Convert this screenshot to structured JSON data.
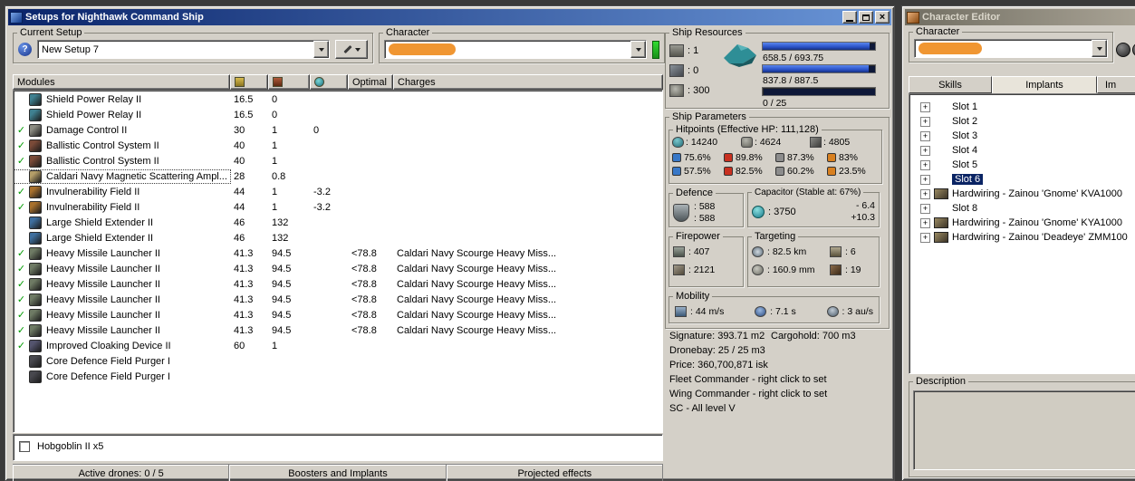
{
  "colors": {
    "redaction": "#f09632",
    "check_green": "#009a00",
    "bar_fill": "#2a52c8",
    "bar_bg": "#0e1838",
    "selection": "#0a2464",
    "indicator_green": "#32dc32",
    "title_active_left": "#0a246a",
    "title_active_right": "#6a96d8",
    "title_inactive_left": "#716e62",
    "title_inactive_right": "#aaa496"
  },
  "main_window": {
    "title": "Setups for Nighthawk Command Ship",
    "window_buttons": [
      "minimize-icon",
      "maximize-icon",
      "close-icon"
    ],
    "current_setup": {
      "legend": "Current Setup",
      "value": "New Setup 7"
    },
    "character_group": {
      "legend": "Character"
    },
    "modules": {
      "columns": {
        "name": "Modules",
        "cpu_icon": "cpu-column-icon",
        "pg_icon": "powergrid-column-icon",
        "cap_icon": "capacitor-column-icon",
        "optimal": "Optimal",
        "charges": "Charges"
      },
      "rows": [
        {
          "check": false,
          "selected": false,
          "icon_color": "#3f8090",
          "name": "Shield Power Relay II",
          "cpu": "16.5",
          "pg": "0",
          "cap": "",
          "optimal": "",
          "charges": ""
        },
        {
          "check": false,
          "selected": false,
          "icon_color": "#3f8090",
          "name": "Shield Power Relay II",
          "cpu": "16.5",
          "pg": "0",
          "cap": "",
          "optimal": "",
          "charges": ""
        },
        {
          "check": true,
          "selected": false,
          "icon_color": "#8c8c82",
          "name": "Damage Control II",
          "cpu": "30",
          "pg": "1",
          "cap": "0",
          "optimal": "",
          "charges": ""
        },
        {
          "check": true,
          "selected": false,
          "icon_color": "#7a4a38",
          "name": "Ballistic Control System II",
          "cpu": "40",
          "pg": "1",
          "cap": "",
          "optimal": "",
          "charges": ""
        },
        {
          "check": true,
          "selected": false,
          "icon_color": "#7a4a38",
          "name": "Ballistic Control System II",
          "cpu": "40",
          "pg": "1",
          "cap": "",
          "optimal": "",
          "charges": ""
        },
        {
          "check": false,
          "selected": true,
          "icon_color": "#b49e68",
          "name": "Caldari Navy Magnetic Scattering Ampl...",
          "cpu": "28",
          "pg": "0.8",
          "cap": "",
          "optimal": "",
          "charges": ""
        },
        {
          "check": true,
          "selected": false,
          "icon_color": "#a8702c",
          "name": "Invulnerability Field II",
          "cpu": "44",
          "pg": "1",
          "cap": "-3.2",
          "optimal": "",
          "charges": ""
        },
        {
          "check": true,
          "selected": false,
          "icon_color": "#a8702c",
          "name": "Invulnerability Field II",
          "cpu": "44",
          "pg": "1",
          "cap": "-3.2",
          "optimal": "",
          "charges": ""
        },
        {
          "check": false,
          "selected": false,
          "icon_color": "#3e6e9e",
          "name": "Large Shield Extender II",
          "cpu": "46",
          "pg": "132",
          "cap": "",
          "optimal": "",
          "charges": ""
        },
        {
          "check": false,
          "selected": false,
          "icon_color": "#3e6e9e",
          "name": "Large Shield Extender II",
          "cpu": "46",
          "pg": "132",
          "cap": "",
          "optimal": "",
          "charges": ""
        },
        {
          "check": true,
          "selected": false,
          "icon_color": "#6e7a64",
          "name": "Heavy Missile Launcher II",
          "cpu": "41.3",
          "pg": "94.5",
          "cap": "",
          "optimal": "<78.8",
          "charges": "Caldari Navy Scourge Heavy Miss..."
        },
        {
          "check": true,
          "selected": false,
          "icon_color": "#6e7a64",
          "name": "Heavy Missile Launcher II",
          "cpu": "41.3",
          "pg": "94.5",
          "cap": "",
          "optimal": "<78.8",
          "charges": "Caldari Navy Scourge Heavy Miss..."
        },
        {
          "check": true,
          "selected": false,
          "icon_color": "#6e7a64",
          "name": "Heavy Missile Launcher II",
          "cpu": "41.3",
          "pg": "94.5",
          "cap": "",
          "optimal": "<78.8",
          "charges": "Caldari Navy Scourge Heavy Miss..."
        },
        {
          "check": true,
          "selected": false,
          "icon_color": "#6e7a64",
          "name": "Heavy Missile Launcher II",
          "cpu": "41.3",
          "pg": "94.5",
          "cap": "",
          "optimal": "<78.8",
          "charges": "Caldari Navy Scourge Heavy Miss..."
        },
        {
          "check": true,
          "selected": false,
          "icon_color": "#6e7a64",
          "name": "Heavy Missile Launcher II",
          "cpu": "41.3",
          "pg": "94.5",
          "cap": "",
          "optimal": "<78.8",
          "charges": "Caldari Navy Scourge Heavy Miss..."
        },
        {
          "check": true,
          "selected": false,
          "icon_color": "#6e7a64",
          "name": "Heavy Missile Launcher II",
          "cpu": "41.3",
          "pg": "94.5",
          "cap": "",
          "optimal": "<78.8",
          "charges": "Caldari Navy Scourge Heavy Miss..."
        },
        {
          "check": true,
          "selected": false,
          "icon_color": "#54546e",
          "name": "Improved Cloaking Device II",
          "cpu": "60",
          "pg": "1",
          "cap": "",
          "optimal": "",
          "charges": ""
        },
        {
          "check": false,
          "selected": false,
          "icon_color": "#48484e",
          "name": "Core Defence Field Purger I",
          "cpu": "",
          "pg": "",
          "cap": "",
          "optimal": "",
          "charges": ""
        },
        {
          "check": false,
          "selected": false,
          "icon_color": "#48484e",
          "name": "Core Defence Field Purger I",
          "cpu": "",
          "pg": "",
          "cap": "",
          "optimal": "",
          "charges": ""
        }
      ]
    },
    "drone_bay": {
      "items": [
        {
          "checked": false,
          "label": "Hobgoblin II x5"
        }
      ]
    },
    "bottom_tabs": [
      "Active drones: 0 / 5",
      "Boosters and Implants",
      "Projected effects"
    ],
    "ship_resources": {
      "legend": "Ship Resources",
      "hardpoints": [
        {
          "icon": "turret-hardpoints-icon",
          "value": "1"
        },
        {
          "icon": "launcher-hardpoints-icon",
          "value": "0"
        },
        {
          "icon": "calibration-icon",
          "value": "300"
        }
      ],
      "bars": [
        {
          "name": "cpu",
          "text": "658.5 / 693.75",
          "fill_pct": 95
        },
        {
          "name": "powergrid",
          "text": "837.8 / 887.5",
          "fill_pct": 94
        },
        {
          "name": "dronebay",
          "text": "0 / 25",
          "fill_pct": 0
        }
      ]
    },
    "ship_parameters": {
      "legend": "Ship Parameters",
      "hitpoints": {
        "legend": "Hitpoints (Effective HP: 111,128)",
        "values": [
          {
            "icon": "shield-hp-icon",
            "value": "14240"
          },
          {
            "icon": "armor-hp-icon",
            "value": "4624"
          },
          {
            "icon": "structure-hp-icon",
            "value": "4805"
          }
        ],
        "resists": [
          {
            "type": "em",
            "color": "#3878c8",
            "shield": "75.6%",
            "armor": "57.5%"
          },
          {
            "type": "thermal",
            "color": "#c83020",
            "shield": "89.8%",
            "armor": "82.5%"
          },
          {
            "type": "kinetic",
            "color": "#8c8c8c",
            "shield": "87.3%",
            "armor": "60.2%"
          },
          {
            "type": "explosive",
            "color": "#d88020",
            "shield": "83%",
            "armor": "23.5%"
          }
        ]
      },
      "defence": {
        "legend": "Defence",
        "values": [
          "588",
          "588"
        ]
      },
      "capacitor": {
        "legend": "Capacitor (Stable at: 67%)",
        "amount": "3750",
        "drain": "- 6.4",
        "recharge": "+10.3"
      },
      "firepower": {
        "legend": "Firepower",
        "values": [
          {
            "icon": "turret-dps-icon",
            "value": "407"
          },
          {
            "icon": "volley-icon",
            "value": "2121"
          }
        ]
      },
      "targeting": {
        "legend": "Targeting",
        "values": [
          {
            "icon": "targeting-range-icon",
            "value": "82.5 km"
          },
          {
            "icon": "max-targets-icon",
            "value": "6"
          },
          {
            "icon": "scan-resolution-icon",
            "value": "160.9 mm"
          },
          {
            "icon": "sensor-strength-icon",
            "value": "19"
          }
        ]
      },
      "mobility": {
        "legend": "Mobility",
        "values": [
          {
            "icon": "max-velocity-icon",
            "value": "44 m/s"
          },
          {
            "icon": "align-time-icon",
            "value": "7.1 s"
          },
          {
            "icon": "warp-speed-icon",
            "value": "3 au/s"
          }
        ]
      }
    },
    "info": {
      "signature": "Signature: 393.71 m2",
      "cargohold": "Cargohold: 700 m3",
      "dronebay": "Dronebay: 25 / 25 m3",
      "price": "Price: 360,700,871 isk",
      "fleet_commander": "Fleet Commander - right click to set",
      "wing_commander": "Wing Commander - right click to set",
      "sc": "SC - All level V"
    }
  },
  "character_editor": {
    "title": "Character Editor",
    "character_group": {
      "legend": "Character"
    },
    "tabs": [
      {
        "label": "Skills",
        "active": false
      },
      {
        "label": "Implants",
        "active": true
      },
      {
        "label": "Im",
        "active": false
      }
    ],
    "tree": [
      {
        "label": "Slot 1",
        "selected": false,
        "hardwiring": false
      },
      {
        "label": "Slot 2",
        "selected": false,
        "hardwiring": false
      },
      {
        "label": "Slot 3",
        "selected": false,
        "hardwiring": false
      },
      {
        "label": "Slot 4",
        "selected": false,
        "hardwiring": false
      },
      {
        "label": "Slot 5",
        "selected": false,
        "hardwiring": false
      },
      {
        "label": "Slot 6",
        "selected": true,
        "hardwiring": false
      },
      {
        "label": "Hardwiring - Zainou 'Gnome' KVA1000",
        "selected": false,
        "hardwiring": true
      },
      {
        "label": "Slot 8",
        "selected": false,
        "hardwiring": false
      },
      {
        "label": "Hardwiring - Zainou 'Gnome' KYA1000",
        "selected": false,
        "hardwiring": true
      },
      {
        "label": "Hardwiring - Zainou 'Deadeye' ZMM100",
        "selected": false,
        "hardwiring": true
      }
    ],
    "description": {
      "legend": "Description"
    }
  }
}
